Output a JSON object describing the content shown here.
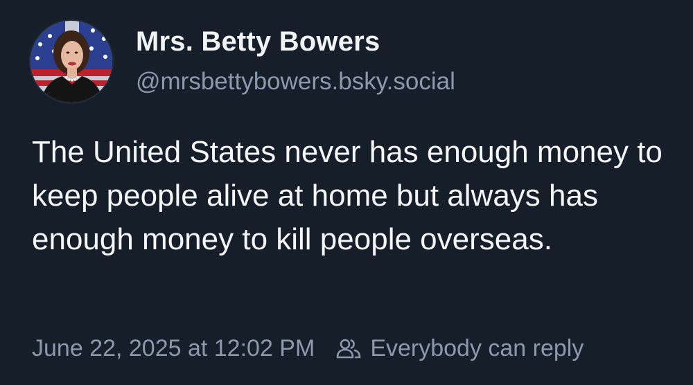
{
  "post": {
    "author": {
      "display_name": "Mrs. Betty Bowers",
      "handle": "@mrsbettybowers.bsky.social",
      "avatar_icon": "profile-photo"
    },
    "text": "The United States never has enough money to keep people alive at home but always has enough money to kill people overseas.",
    "timestamp": "June 22, 2025 at 12:02 PM",
    "reply_setting": {
      "icon": "people-icon",
      "label": "Everybody can reply"
    }
  },
  "colors": {
    "background": "#161e2a",
    "primary_text": "#f1f3f5",
    "secondary_text": "#8c99ad"
  }
}
